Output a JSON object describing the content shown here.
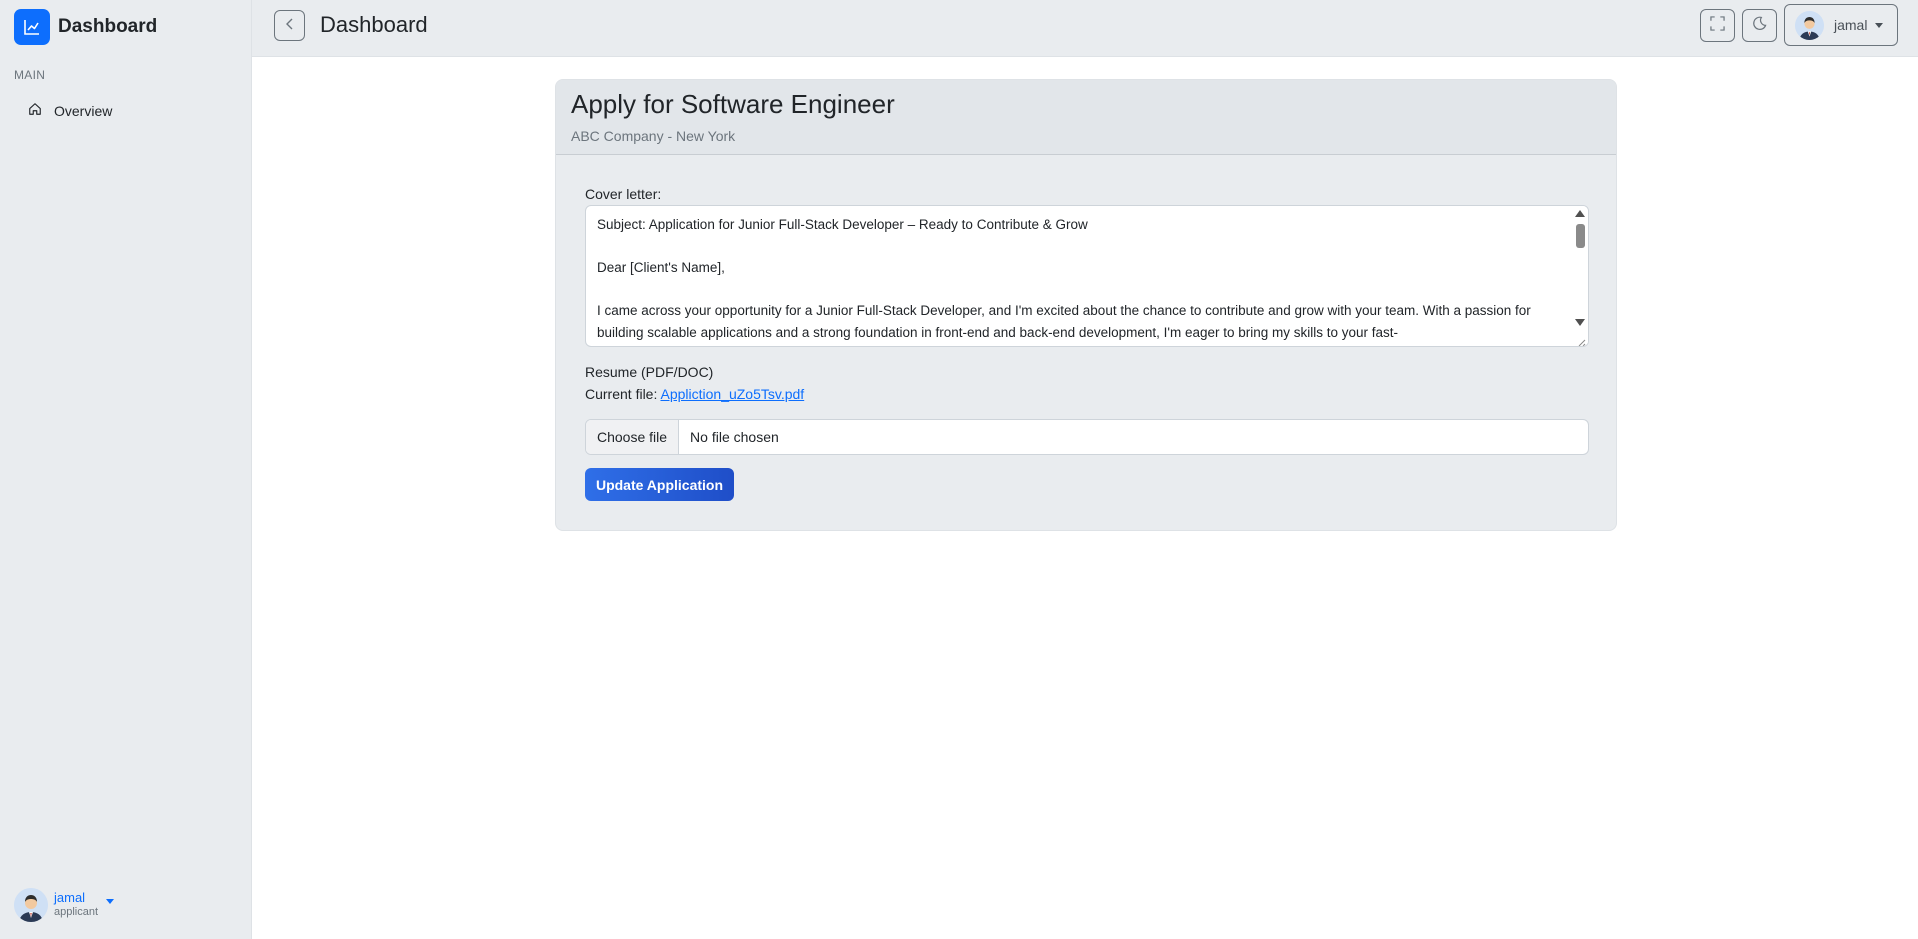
{
  "sidebar": {
    "brand": "Dashboard",
    "brand_icon": "chart-line-icon",
    "section_label": "MAIN",
    "items": [
      {
        "label": "Overview",
        "icon": "home-icon"
      }
    ],
    "user": {
      "name": "jamal",
      "role": "applicant"
    }
  },
  "topbar": {
    "title": "Dashboard",
    "back_icon": "chevron-left-icon",
    "fullscreen_icon": "fullscreen-icon",
    "theme_icon": "moon-icon",
    "user_name": "jamal"
  },
  "form": {
    "job_title": "Apply for Software Engineer",
    "company": "ABC Company - New York",
    "cover_label": "Cover letter:",
    "cover_text": "Subject: Application for Junior Full-Stack Developer – Ready to Contribute & Grow\n\nDear [Client's Name],\n\nI came across your opportunity for a Junior Full-Stack Developer, and I'm excited about the chance to contribute and grow with your team. With a passion for building scalable applications and a strong foundation in front-end and back-end development, I'm eager to bring my skills to your fast-",
    "resume_label": "Resume (PDF/DOC)",
    "current_file_prefix": "Current file:",
    "current_file_name": "Appliction_uZo5Tsv.pdf",
    "choose_file_label": "Choose file",
    "file_status": "No file chosen",
    "submit_label": "Update Application"
  },
  "colors": {
    "accent": "#0d6efd",
    "sidebar_bg": "#e9ecef",
    "card_bg": "#e9ecef"
  }
}
